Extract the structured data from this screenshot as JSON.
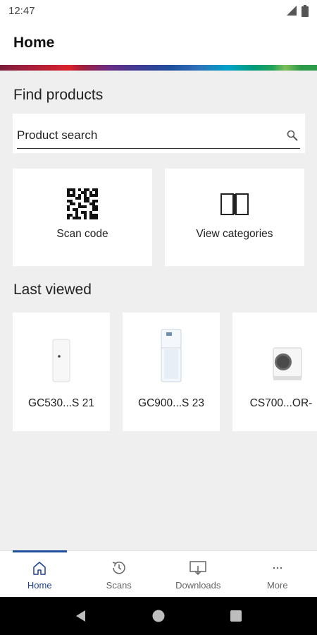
{
  "status_bar": {
    "time": "12:47"
  },
  "app_bar": {
    "title": "Home"
  },
  "find_products": {
    "title": "Find products",
    "search_placeholder": "Product search"
  },
  "tiles": [
    {
      "label": "Scan code",
      "icon": "qr-code-icon"
    },
    {
      "label": "View categories",
      "icon": "open-book-icon"
    }
  ],
  "last_viewed": {
    "title": "Last viewed",
    "items": [
      {
        "name": "GC530...S 21"
      },
      {
        "name": "GC900...S 23"
      },
      {
        "name": "CS700...OR-"
      }
    ]
  },
  "bottom_nav": {
    "items": [
      {
        "label": "Home",
        "icon": "home-icon",
        "active": true
      },
      {
        "label": "Scans",
        "icon": "history-icon"
      },
      {
        "label": "Downloads",
        "icon": "download-icon"
      },
      {
        "label": "More",
        "icon": "more-icon"
      }
    ]
  },
  "colors": {
    "accent": "#1f4f9c",
    "background": "#efefef",
    "card": "#ffffff"
  }
}
